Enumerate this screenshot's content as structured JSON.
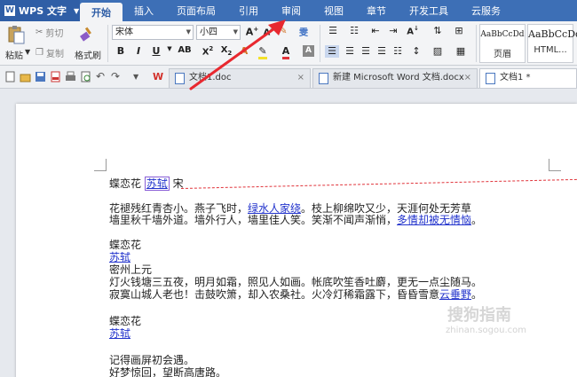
{
  "app": {
    "name": "WPS 文字"
  },
  "menu_tabs": [
    "开始",
    "插入",
    "页面布局",
    "引用",
    "审阅",
    "视图",
    "章节",
    "开发工具",
    "云服务"
  ],
  "ribbon": {
    "paste": "粘贴",
    "cut": "剪切",
    "copy": "复制",
    "format_painter": "格式刷",
    "font_name": "宋体",
    "font_size": "小四",
    "styles": [
      {
        "preview": "AaBbCcDd",
        "name": "页眉"
      },
      {
        "preview": "AaBbCcDd",
        "name": "HTML..."
      }
    ]
  },
  "doc_tabs": [
    {
      "title": "文档1.doc",
      "active": false
    },
    {
      "title": "新建 Microsoft Word 文档.docx",
      "active": false
    },
    {
      "title": "文档1 *",
      "active": true
    }
  ],
  "document": {
    "line1": {
      "a": "蝶恋花 ",
      "b": "苏轼",
      "c": " 宋"
    },
    "line2": {
      "a": "花褪残红青杏小。燕子飞时，",
      "b": "绿水人家绕",
      "c": "。枝上柳绵吹又少，天涯何处无芳草"
    },
    "line3": {
      "a": "墙里秋千墙外道。墙外行人，墙里佳人笑。笑渐不闻声渐悄，",
      "b": "多情却被无情恼",
      "c": "。"
    },
    "line4": "蝶恋花",
    "line5": "苏轼",
    "line6": "密州上元",
    "line7": "灯火钱塘三五夜，明月如霜，照见人如画。帐底吹笙香吐麝，更无一点尘随马。",
    "line8": {
      "a": "寂寞山城人老也！击鼓吹箫，却入农桑社。火冷灯稀霜露下，昏昏雪意",
      "b": "云垂野",
      "c": "。"
    },
    "line9": "蝶恋花",
    "line10": "苏轼",
    "line11": "记得画屏初会遇。",
    "line12": "好梦惊回，望断高唐路。"
  },
  "watermark": {
    "text": "搜狗指南",
    "url": "zhinan.sogou.com"
  },
  "colors": {
    "title_bar": "#3d6fb6",
    "link": "#2233cc",
    "track_change": "#e0333a",
    "arrow": "#e8282f"
  }
}
